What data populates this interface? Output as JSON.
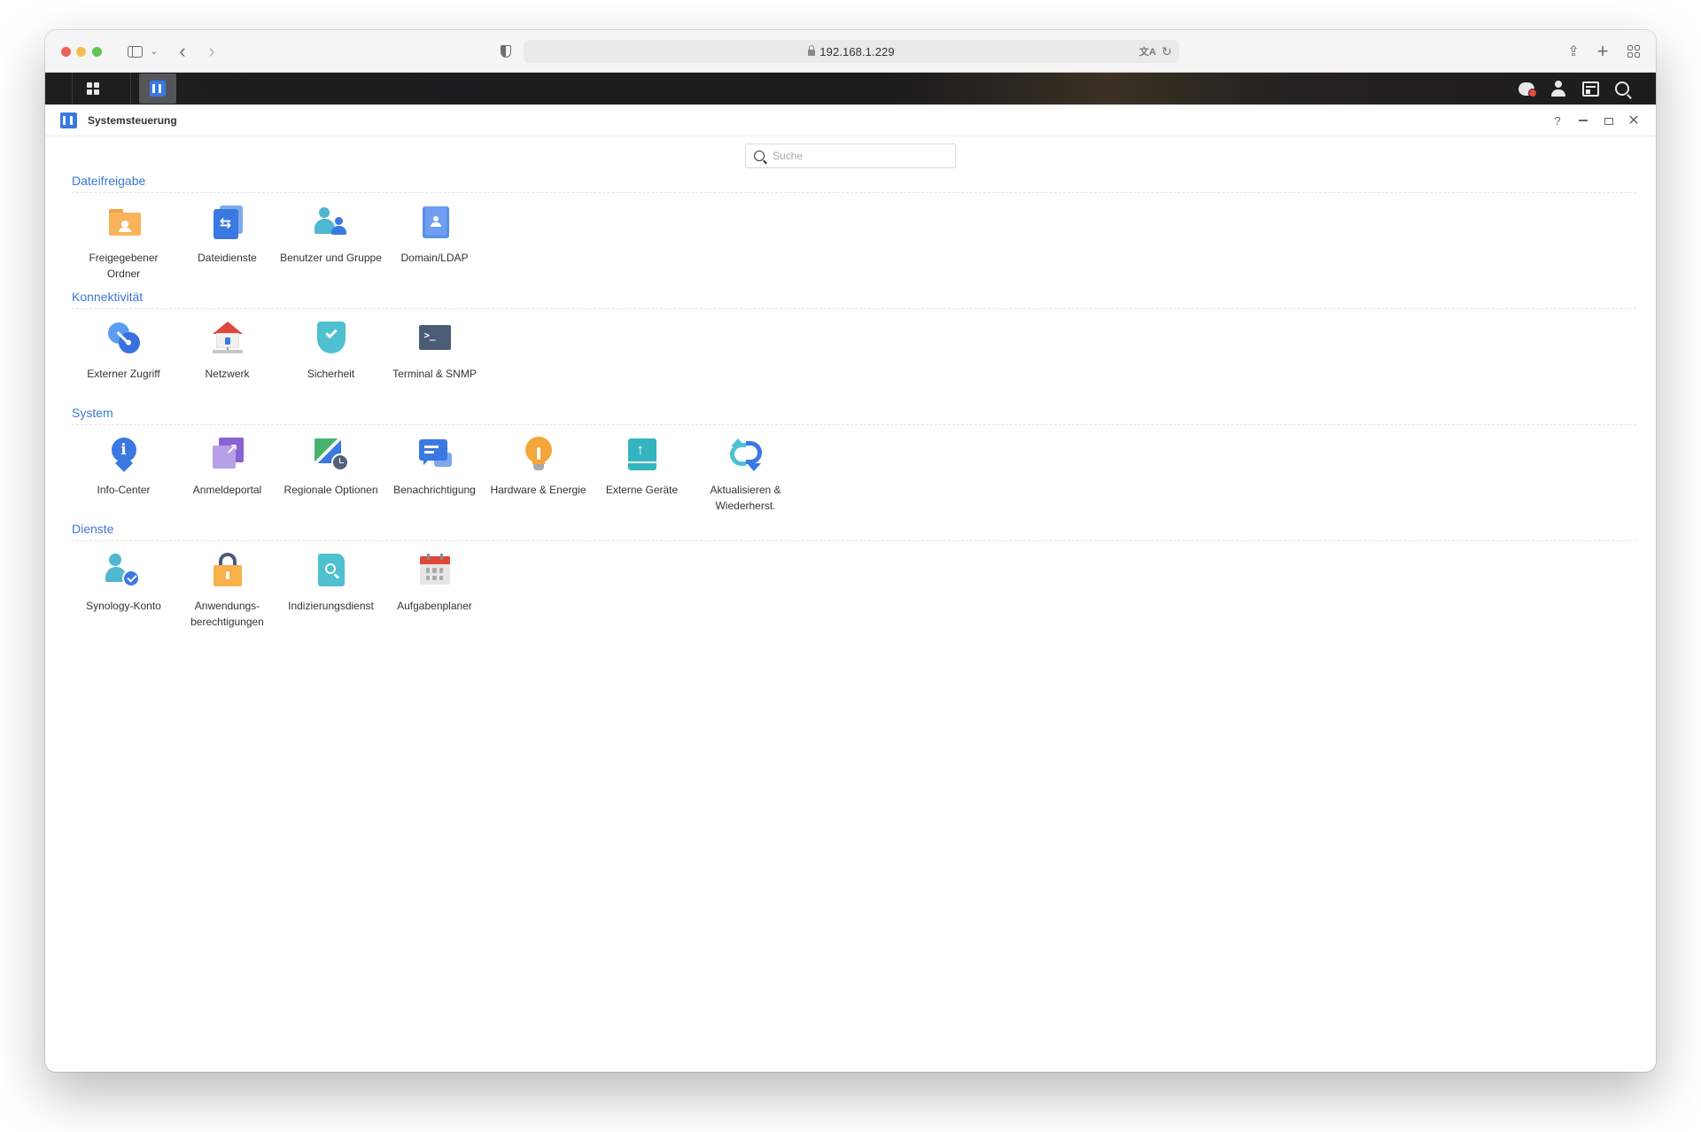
{
  "browser": {
    "url": "192.168.1.229"
  },
  "window": {
    "title": "Systemsteuerung",
    "help_label": "?"
  },
  "search": {
    "placeholder": "Suche"
  },
  "sections": [
    {
      "title": "Dateifreigabe",
      "items": [
        {
          "label": "Freigegebener Ordner",
          "icon": "shared-folder-icon"
        },
        {
          "label": "Dateidienste",
          "icon": "file-services-icon"
        },
        {
          "label": "Benutzer und Gruppe",
          "icon": "user-group-icon"
        },
        {
          "label": "Domain/LDAP",
          "icon": "domain-ldap-icon"
        }
      ]
    },
    {
      "title": "Konnektivität",
      "items": [
        {
          "label": "Externer Zugriff",
          "icon": "external-access-icon"
        },
        {
          "label": "Netzwerk",
          "icon": "network-icon"
        },
        {
          "label": "Sicherheit",
          "icon": "security-icon"
        },
        {
          "label": "Terminal & SNMP",
          "icon": "terminal-icon"
        }
      ]
    },
    {
      "title": "System",
      "items": [
        {
          "label": "Info-Center",
          "icon": "info-center-icon"
        },
        {
          "label": "Anmeldeportal",
          "icon": "login-portal-icon"
        },
        {
          "label": "Regionale Optionen",
          "icon": "regional-options-icon"
        },
        {
          "label": "Benachrichtigung",
          "icon": "notification-icon"
        },
        {
          "label": "Hardware & Energie",
          "icon": "hardware-power-icon"
        },
        {
          "label": "Externe Geräte",
          "icon": "external-devices-icon"
        },
        {
          "label": "Aktualisieren & Wiederherst.",
          "icon": "update-restore-icon"
        }
      ]
    },
    {
      "title": "Dienste",
      "items": [
        {
          "label": "Synology-Konto",
          "icon": "synology-account-icon"
        },
        {
          "label": "Anwendungs-berechtigungen",
          "icon": "application-privileges-icon"
        },
        {
          "label": "Indizierungsdienst",
          "icon": "indexing-service-icon"
        },
        {
          "label": "Aufgabenplaner",
          "icon": "task-scheduler-icon"
        }
      ]
    }
  ],
  "colors": {
    "accent": "#3a78d6",
    "taskbar": "#1c1c1d"
  }
}
